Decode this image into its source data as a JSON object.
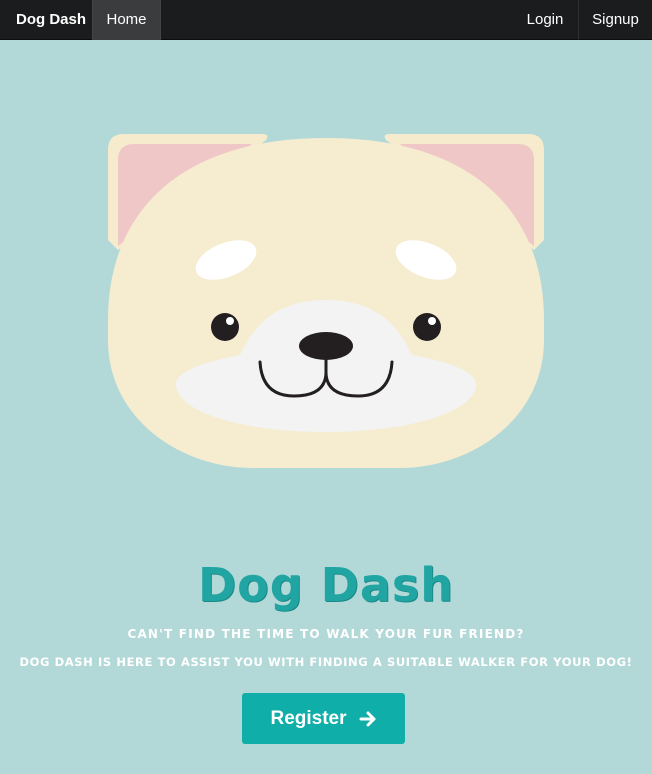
{
  "navbar": {
    "brand": "Dog Dash",
    "home": "Home",
    "login": "Login",
    "signup": "Signup"
  },
  "hero": {
    "title": "Dog Dash",
    "tagline_1": "Can't find the time to walk your fur friend?",
    "tagline_2": "Dog Dash is here to assist you with finding a suitable walker for your dog!",
    "register_label": "Register",
    "register_icon": "arrow-right-icon"
  },
  "colors": {
    "background": "#b2d9d8",
    "navbar": "#1b1c1e",
    "accent": "#10aea9",
    "title": "#21a5a3"
  }
}
